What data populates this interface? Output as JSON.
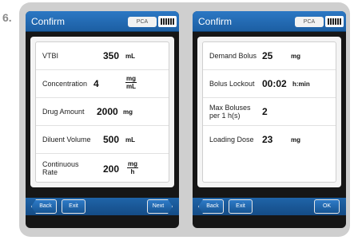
{
  "step_number": "6.",
  "left_screen": {
    "title": "Confirm",
    "mode": "PCA",
    "rows": [
      {
        "label": "VTBI",
        "value": "350",
        "unit": "mL"
      },
      {
        "label": "Concentration",
        "value": "4",
        "unit_num": "mg",
        "unit_den": "mL"
      },
      {
        "label": "Drug Amount",
        "value": "2000",
        "unit": "mg"
      },
      {
        "label": "Diluent Volume",
        "value": "500",
        "unit": "mL"
      },
      {
        "label_line1": "Continuous",
        "label_line2": "Rate",
        "value": "200",
        "unit_num": "mg",
        "unit_den": "h"
      }
    ],
    "buttons": {
      "back": "Back",
      "exit": "Exit",
      "next": "Next"
    }
  },
  "right_screen": {
    "title": "Confirm",
    "mode": "PCA",
    "rows": [
      {
        "label": "Demand Bolus",
        "value": "25",
        "unit": "mg"
      },
      {
        "label": "Bolus Lockout",
        "value": "00:02",
        "unit": "h:min"
      },
      {
        "label_line1": "Max Boluses",
        "label_line2": "per 1 h(s)",
        "value": "2"
      },
      {
        "label": "Loading Dose",
        "value": "23",
        "unit": "mg"
      }
    ],
    "buttons": {
      "back": "Back",
      "exit": "Exit",
      "ok": "OK"
    }
  }
}
